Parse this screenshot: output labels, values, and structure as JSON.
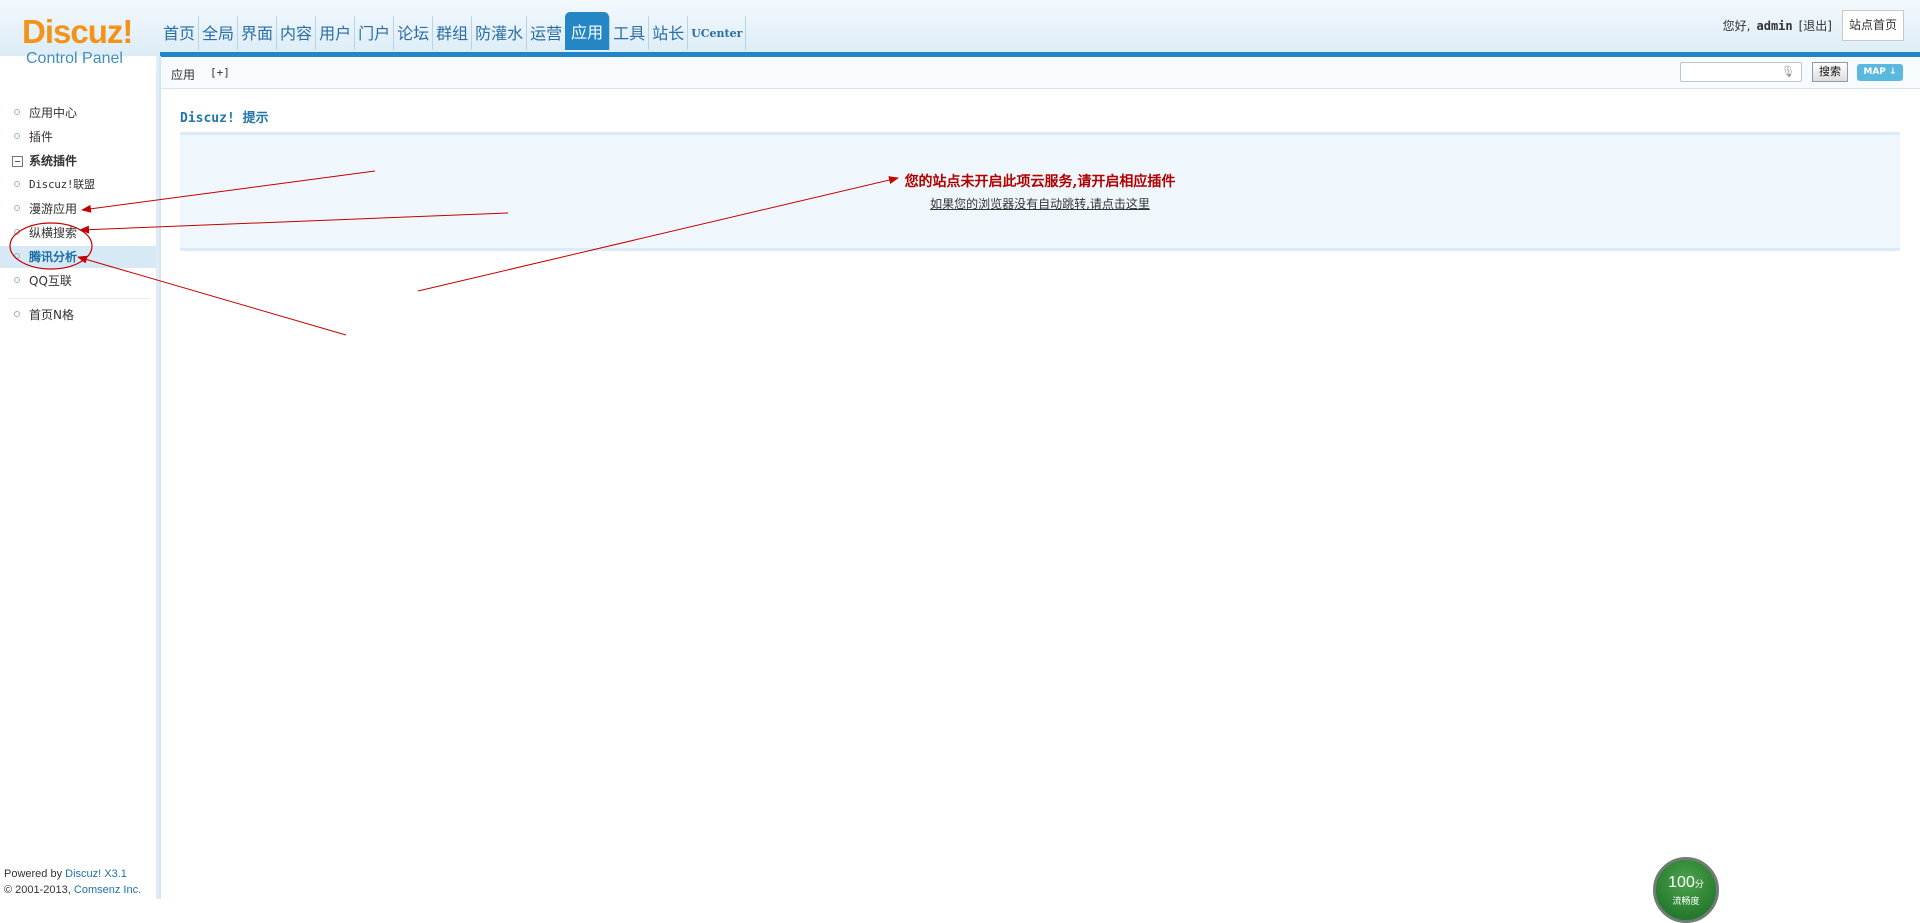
{
  "logo": {
    "brand": "Discuz!",
    "subtitle": "Control Panel"
  },
  "topnav": {
    "items": [
      {
        "label": "首页"
      },
      {
        "label": "全局"
      },
      {
        "label": "界面"
      },
      {
        "label": "内容"
      },
      {
        "label": "用户"
      },
      {
        "label": "门户"
      },
      {
        "label": "论坛"
      },
      {
        "label": "群组"
      },
      {
        "label": "防灌水"
      },
      {
        "label": "运营"
      },
      {
        "label": "应用"
      },
      {
        "label": "工具"
      },
      {
        "label": "站长"
      },
      {
        "label": "UCenter"
      }
    ],
    "active": "应用"
  },
  "user": {
    "greeting": "您好,",
    "name": "admin",
    "logout": "[退出]",
    "site_home": "站点首页"
  },
  "subbar": {
    "crumb": "应用",
    "add": "[+]"
  },
  "search": {
    "placeholder": "",
    "button": "搜索",
    "map": "MAP ↓"
  },
  "sidebar": {
    "items": [
      {
        "label": "应用中心"
      },
      {
        "label": "插件"
      },
      {
        "label": "系统插件"
      },
      {
        "label": "Discuz!联盟"
      },
      {
        "label": "漫游应用"
      },
      {
        "label": "纵横搜索"
      },
      {
        "label": "腾讯分析"
      },
      {
        "label": "QQ互联"
      },
      {
        "label": "首页N格"
      }
    ],
    "active": "腾讯分析"
  },
  "footer": {
    "powered": "Powered by ",
    "product": "Discuz! X3.1",
    "copyright": "© 2001-2013, ",
    "company": "Comsenz Inc."
  },
  "content": {
    "title": "Discuz! 提示",
    "message": "您的站点未开启此项云服务,请开启相应插件",
    "redirect": "如果您的浏览器没有自动跳转,请点击这里"
  },
  "badge": {
    "score": "100",
    "unit": "分",
    "text": "流畅度"
  },
  "colors": {
    "brand_orange": "#f39319",
    "nav_blue": "#1f86c7",
    "alert_red": "#b00000",
    "annotation_red": "#c40000"
  }
}
